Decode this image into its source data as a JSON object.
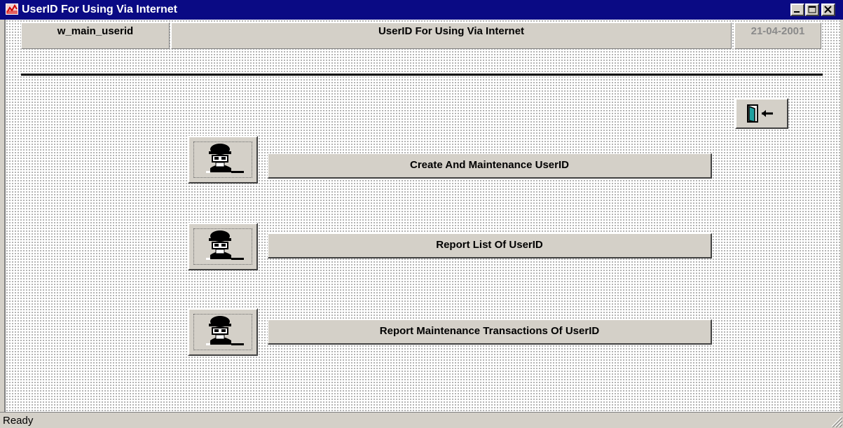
{
  "window": {
    "title": "UserID For Using Via Internet",
    "app_icon": "chart-app-icon",
    "caption_buttons": [
      "minimize-icon",
      "maximize-icon",
      "close-icon"
    ]
  },
  "header": {
    "window_name": "w_main_userid",
    "title": "UserID For Using Via Internet",
    "date": "21-04-2001"
  },
  "exit_button": {
    "icon": "exit-door-icon"
  },
  "menu": {
    "items": [
      {
        "label": "Create And Maintenance UserID",
        "icon": "user-agent-icon"
      },
      {
        "label": "Report List Of UserID",
        "icon": "user-agent-icon"
      },
      {
        "label": "Report Maintenance Transactions Of UserID",
        "icon": "user-agent-icon"
      }
    ]
  },
  "status": {
    "text": "Ready"
  },
  "colors": {
    "titlebar": "#0a0a84",
    "face": "#d4d0c8",
    "date_text": "#8a8a8a"
  }
}
